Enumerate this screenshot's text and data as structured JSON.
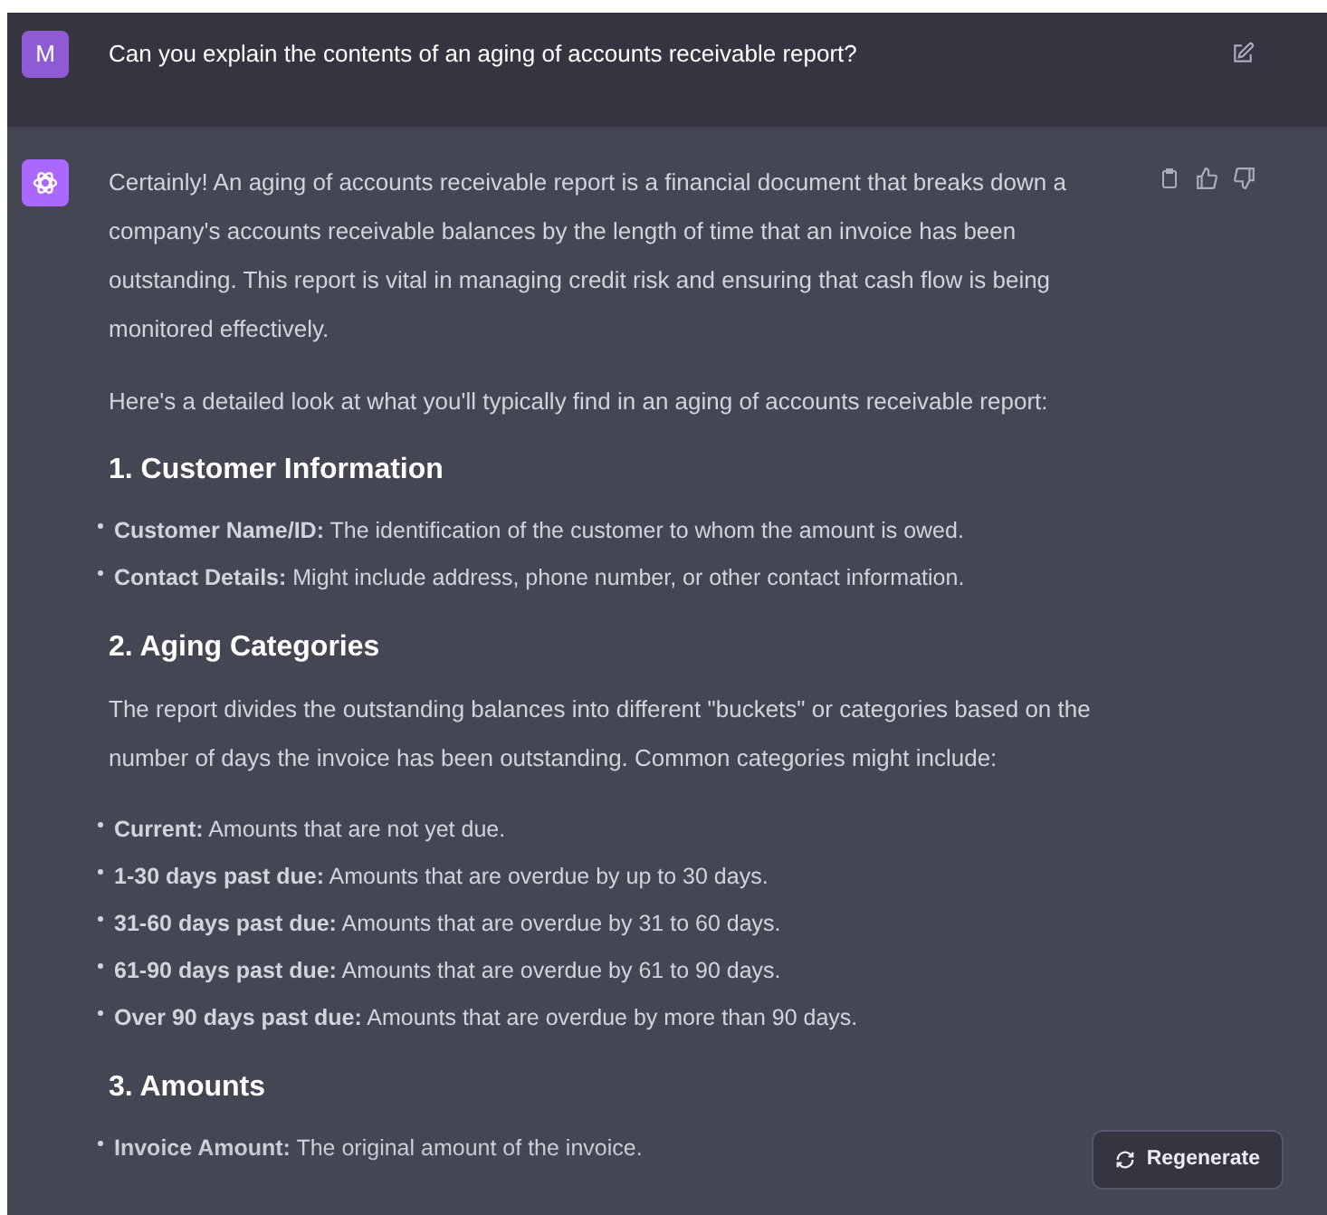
{
  "user_message": {
    "avatar": "M",
    "text": "Can you explain the contents of an aging of accounts receivable report?"
  },
  "assistant_message": {
    "blocks": [
      {
        "kind": "paragraph",
        "text": "Certainly! An aging of accounts receivable report is a financial document that breaks down a company's accounts receivable balances by the length of time that an invoice has been outstanding. This report is vital in managing credit risk and ensuring that cash flow is being monitored effectively."
      },
      {
        "kind": "paragraph",
        "text": "Here's a detailed look at what you'll typically find in an aging of accounts receivable report:"
      },
      {
        "kind": "heading",
        "text": "1. Customer Information"
      },
      {
        "kind": "list",
        "items": [
          "**Customer Name/ID:** The identification of the customer to whom the amount is owed.",
          "**Contact Details:** Might include address, phone number, or other contact information."
        ]
      },
      {
        "kind": "heading",
        "text": "2. Aging Categories"
      },
      {
        "kind": "paragraph",
        "text": "The report divides the outstanding balances into different \"buckets\" or categories based on the number of days the invoice has been outstanding. Common categories might include:"
      },
      {
        "kind": "list",
        "items": [
          "**Current:** Amounts that are not yet due.",
          "**1-30 days past due:** Amounts that are overdue by up to 30 days.",
          "**31-60 days past due:** Amounts that are overdue by 31 to 60 days.",
          "**61-90 days past due:** Amounts that are overdue by 61 to 90 days.",
          "**Over 90 days past due:** Amounts that are overdue by more than 90 days."
        ]
      },
      {
        "kind": "heading",
        "text": "3. Amounts"
      },
      {
        "kind": "list",
        "items": [
          "**Invoice Amount:** The original amount of the invoice."
        ]
      }
    ]
  },
  "regenerate_button": {
    "label": "Regenerate"
  }
}
